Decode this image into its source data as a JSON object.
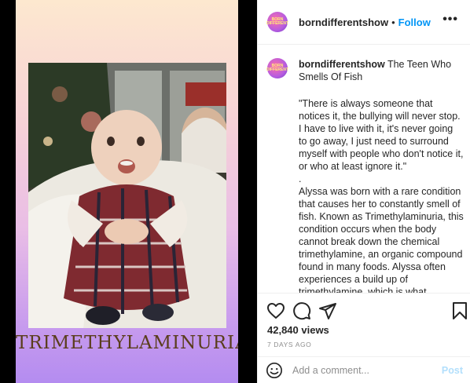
{
  "post": {
    "media": {
      "overlay_text": "TRIMETHYLAMINURIA"
    },
    "header": {
      "username": "borndifferentshow",
      "separator": "•",
      "follow_label": "Follow",
      "more_label": "•••",
      "avatar_text": "BORN DIFFERENT"
    },
    "caption": {
      "username": "borndifferentshow",
      "title": "The Teen Who Smells Of Fish",
      "body": "\"There is always someone that notices it, the bullying will never stop. I have to live with it, it's never going to go away, I just need to surround myself with people who don't notice it, or who at least ignore it.\"\n.\nAlyssa was born with a rare condition that causes her to constantly smell of fish. Known as Trimethylaminuria, this condition occurs when the body cannot break down the chemical trimethylamine, an organic compound found in many foods. Alyssa often experiences a build up of trimethylamine, which is what"
    },
    "actions": {
      "like_icon": "heart-icon",
      "comment_icon": "comment-icon",
      "share_icon": "share-icon",
      "save_icon": "bookmark-icon"
    },
    "stats": {
      "views": "42,840 views",
      "date": "7 DAYS AGO"
    },
    "comment_box": {
      "placeholder": "Add a comment...",
      "post_label": "Post",
      "emoji_icon": "emoji-icon"
    },
    "colors": {
      "follow": "#0095f6",
      "post_disabled": "#b2dffc",
      "muted": "#8e8e8e",
      "border": "#efefef"
    }
  }
}
